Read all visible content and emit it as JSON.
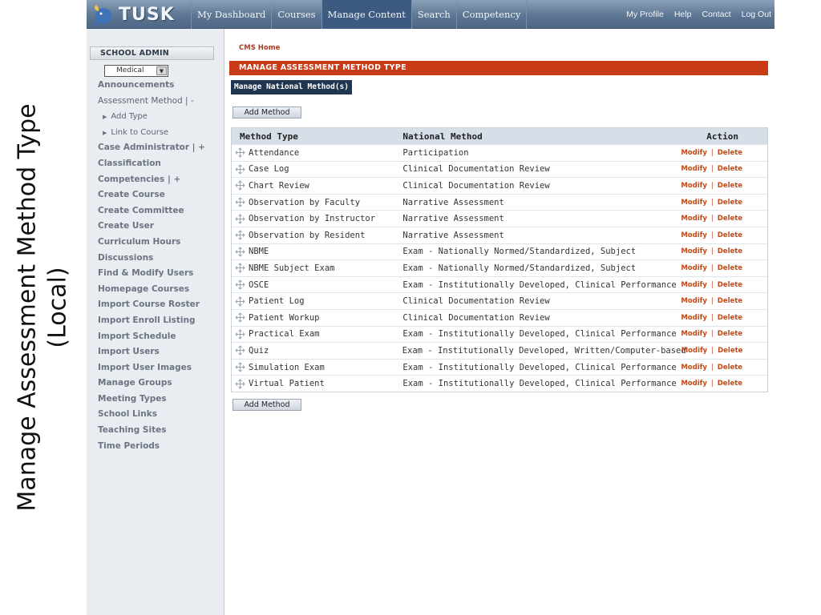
{
  "slide": {
    "caption_line1": "Manage Assessment Method Type",
    "caption_line2": "(Local)"
  },
  "header": {
    "logo_text": "TUSK",
    "tabs": [
      "My Dashboard",
      "Courses",
      "Manage Content",
      "Search",
      "Competency"
    ],
    "active_tab": "Manage Content",
    "links": [
      "My Profile",
      "Help",
      "Contact",
      "Log Out"
    ]
  },
  "sidebar": {
    "title": "SCHOOL ADMIN",
    "school_select": "Medical",
    "items": [
      {
        "label": "Announcements",
        "kind": "bold"
      },
      {
        "label": "Assessment Method  | -",
        "kind": "normal"
      },
      {
        "label": "Add Type",
        "kind": "sub"
      },
      {
        "label": "Link to Course",
        "kind": "sub"
      },
      {
        "label": "Case Administrator | +",
        "kind": "bold"
      },
      {
        "label": "Classification",
        "kind": "bold"
      },
      {
        "label": "Competencies | +",
        "kind": "bold"
      },
      {
        "label": "Create Course",
        "kind": "bold"
      },
      {
        "label": "Create Committee",
        "kind": "bold"
      },
      {
        "label": "Create User",
        "kind": "bold"
      },
      {
        "label": "Curriculum Hours",
        "kind": "bold"
      },
      {
        "label": "Discussions",
        "kind": "bold"
      },
      {
        "label": "Find & Modify Users",
        "kind": "bold"
      },
      {
        "label": "Homepage Courses",
        "kind": "bold"
      },
      {
        "label": "Import Course Roster",
        "kind": "bold"
      },
      {
        "label": "Import Enroll Listing",
        "kind": "bold"
      },
      {
        "label": "Import Schedule",
        "kind": "bold"
      },
      {
        "label": "Import Users",
        "kind": "bold"
      },
      {
        "label": "Import User Images",
        "kind": "bold"
      },
      {
        "label": "Manage Groups",
        "kind": "bold"
      },
      {
        "label": "Meeting Types",
        "kind": "bold"
      },
      {
        "label": "School Links",
        "kind": "bold"
      },
      {
        "label": "Teaching Sites",
        "kind": "bold"
      },
      {
        "label": "Time Periods",
        "kind": "bold"
      }
    ]
  },
  "main": {
    "breadcrumb": "CMS Home",
    "section_title": "MANAGE ASSESSMENT METHOD TYPE",
    "subtab": "Manage National Method(s)",
    "add_button": "Add Method",
    "columns": [
      "Method Type",
      "National Method",
      "Action"
    ],
    "modify_label": "Modify",
    "delete_label": "Delete",
    "action_separator": "|",
    "rows": [
      {
        "type": "Attendance",
        "national": "Participation"
      },
      {
        "type": "Case Log",
        "national": "Clinical Documentation Review"
      },
      {
        "type": "Chart Review",
        "national": "Clinical Documentation Review"
      },
      {
        "type": "Observation by Faculty",
        "national": "Narrative Assessment"
      },
      {
        "type": "Observation by Instructor",
        "national": "Narrative Assessment"
      },
      {
        "type": "Observation by Resident",
        "national": "Narrative Assessment"
      },
      {
        "type": "NBME",
        "national": "Exam - Nationally Normed/Standardized, Subject"
      },
      {
        "type": "NBME Subject Exam",
        "national": "Exam - Nationally Normed/Standardized, Subject"
      },
      {
        "type": "OSCE",
        "national": "Exam - Institutionally Developed, Clinical Performance"
      },
      {
        "type": "Patient Log",
        "national": "Clinical Documentation Review"
      },
      {
        "type": "Patient Workup",
        "national": "Clinical Documentation Review"
      },
      {
        "type": "Practical Exam",
        "national": "Exam - Institutionally Developed, Clinical Performance"
      },
      {
        "type": "Quiz",
        "national": "Exam - Institutionally Developed, Written/Computer-based"
      },
      {
        "type": "Simulation Exam",
        "national": "Exam - Institutionally Developed, Clinical Performance"
      },
      {
        "type": "Virtual Patient",
        "national": "Exam - Institutionally Developed, Clinical Performance"
      }
    ]
  }
}
